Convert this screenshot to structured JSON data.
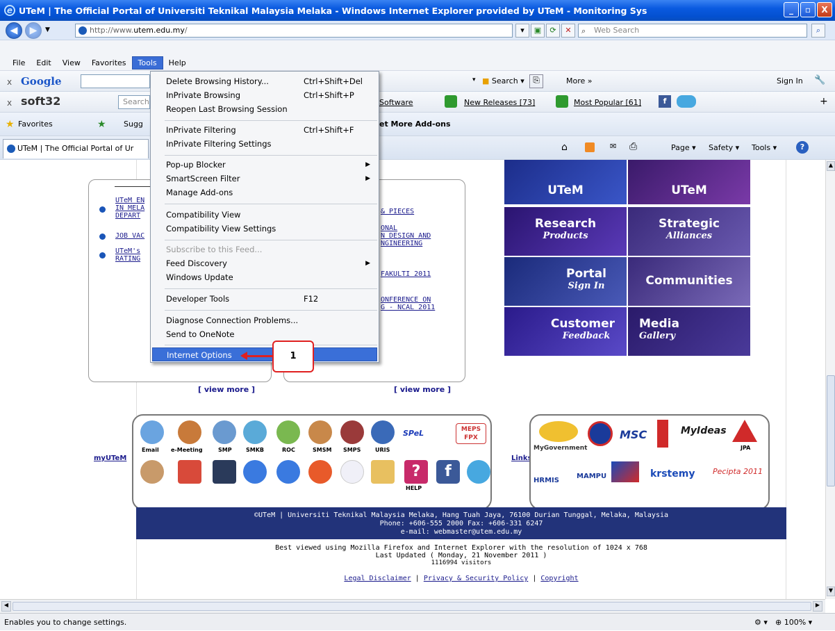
{
  "window": {
    "title": "UTeM | The Official Portal of Universiti Teknikal Malaysia Melaka - Windows Internet Explorer provided by UTeM - Monitoring Sys",
    "minimize": "_",
    "maximize": "▫",
    "close": "X"
  },
  "address": {
    "prefix": "http://www.",
    "domain": "utem.edu.my",
    "suffix": "/",
    "search_placeholder": "Web Search"
  },
  "menubar": [
    "File",
    "Edit",
    "View",
    "Favorites",
    "Tools",
    "Help"
  ],
  "google_bar": {
    "label": "Google",
    "search_btn": "Search",
    "more": "More »",
    "sign_in": "Sign In"
  },
  "soft32_bar": {
    "label": "soft32",
    "search_placeholder": "Search",
    "software": "Software",
    "new_releases": "New Releases [73]",
    "most_popular": "Most Popular [61]"
  },
  "fav_bar": {
    "favorites": "Favorites",
    "suggested": "Sugg",
    "get_more": "et More Add-ons"
  },
  "tab": {
    "title": "UTeM | The Official Portal of Ur",
    "page": "Page",
    "safety": "Safety",
    "tools": "Tools"
  },
  "tools_menu": {
    "items": [
      {
        "label": "Delete Browsing History...",
        "shortcut": "Ctrl+Shift+Del"
      },
      {
        "label": "InPrivate Browsing",
        "shortcut": "Ctrl+Shift+P"
      },
      {
        "label": "Reopen Last Browsing Session",
        "shortcut": ""
      },
      {
        "label": "InPrivate Filtering",
        "shortcut": "Ctrl+Shift+F"
      },
      {
        "label": "InPrivate Filtering Settings",
        "shortcut": ""
      },
      {
        "label": "Pop-up Blocker",
        "shortcut": ""
      },
      {
        "label": "SmartScreen Filter",
        "shortcut": ""
      },
      {
        "label": "Manage Add-ons",
        "shortcut": ""
      },
      {
        "label": "Compatibility View",
        "shortcut": ""
      },
      {
        "label": "Compatibility View Settings",
        "shortcut": ""
      },
      {
        "label": "Subscribe to this Feed...",
        "shortcut": ""
      },
      {
        "label": "Feed Discovery",
        "shortcut": ""
      },
      {
        "label": "Windows Update",
        "shortcut": ""
      },
      {
        "label": "Developer Tools",
        "shortcut": "F12"
      },
      {
        "label": "Diagnose Connection Problems...",
        "shortcut": ""
      },
      {
        "label": "Send to OneNote",
        "shortcut": ""
      },
      {
        "label": "Internet Options",
        "shortcut": ""
      }
    ]
  },
  "callout": "1",
  "news_left": [
    "UTeM EN",
    "IN MELA",
    "DEPART",
    "JOB VAC",
    "UTeM's",
    "RATING"
  ],
  "news_right": [
    "& PIECES",
    "ONAL",
    "N DESIGN AND",
    "NGINEERING",
    "FAKULTI 2011",
    "ONFERENCE ON",
    "G - NCAL 2011"
  ],
  "view_more": "[ view more ]",
  "tiles": {
    "vc": "UTeM",
    "pub": "UTeM",
    "research": "Research",
    "research_sub": "Products",
    "strategic": "Strategic",
    "strategic_sub": "Alliances",
    "portal": "Portal",
    "portal_sub": "Sign In",
    "communities": "Communities",
    "customer": "Customer",
    "customer_sub": "Feedback",
    "media": "Media",
    "media_sub": "Gallery"
  },
  "myutem": {
    "label": "myUTeM",
    "row1": [
      "Email",
      "e-Meeting",
      "SMP",
      "SMKB",
      "ROC",
      "SMSM",
      "SMPS",
      "URIS",
      "MEPS FPX"
    ],
    "help": "HELP"
  },
  "links": {
    "label": "Links",
    "row1": [
      "MyGovernment",
      "MSC",
      "MyIdeas",
      "JPA"
    ],
    "row2": [
      "HRMIS",
      "MAMPU",
      "krstemy",
      "Pecipta 2011"
    ]
  },
  "footer": {
    "line1": "©UTeM | Universiti Teknikal Malaysia Melaka, Hang Tuah Jaya, 76100 Durian Tunggal, Melaka, Malaysia",
    "line2": "Phone: +606-555 2000 Fax: +606-331 6247",
    "line3": "e-mail: webmaster@utem.edu.my",
    "best": "Best viewed using Mozilla Firefox and Internet Explorer with the resolution of 1024 x 768",
    "updated": "Last Updated ( Monday, 21 November 2011 )",
    "visitors": "1116994 visitors",
    "legal": "Legal Disclaimer",
    "privacy": "Privacy & Security Policy",
    "copyright": "Copyright"
  },
  "status": {
    "text": "Enables you to change settings.",
    "zoom": "100%"
  }
}
